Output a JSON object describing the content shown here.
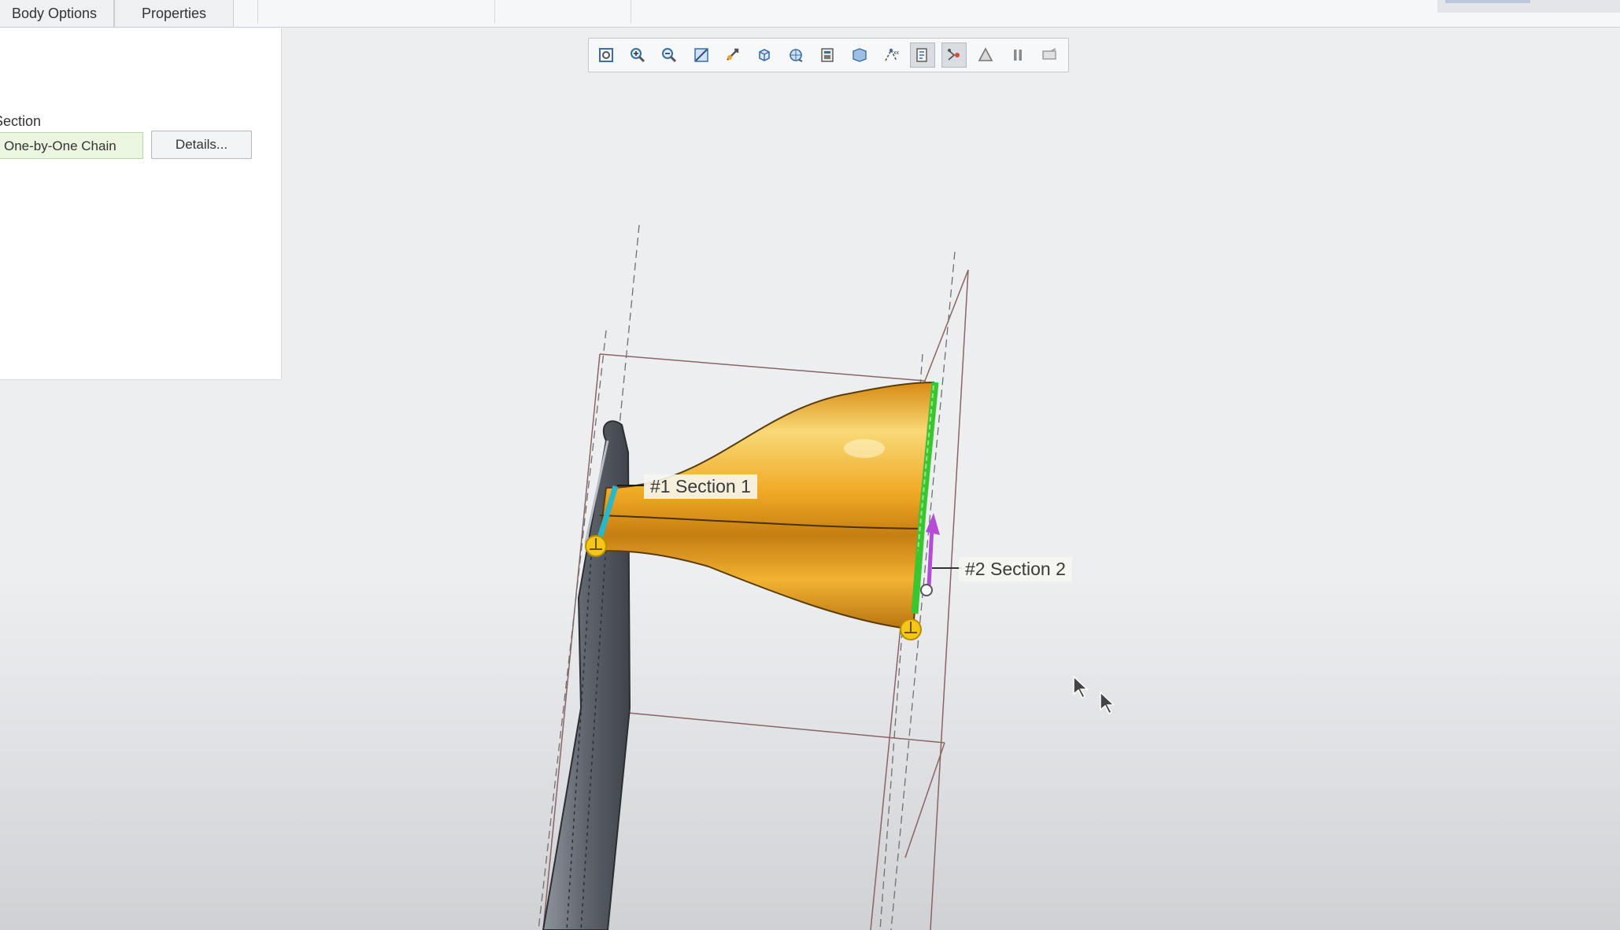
{
  "tabs": [
    {
      "label": "Body Options"
    },
    {
      "label": "Properties"
    }
  ],
  "panel": {
    "section_label": "Section",
    "chain_type": "One-by-One Chain",
    "details_button": "Details..."
  },
  "toolbar": {
    "buttons": [
      {
        "icon": "refit-icon",
        "active": false
      },
      {
        "icon": "zoom-in-icon",
        "active": false
      },
      {
        "icon": "zoom-out-icon",
        "active": false
      },
      {
        "icon": "repaint-icon",
        "active": false
      },
      {
        "icon": "pan-icon",
        "active": false
      },
      {
        "icon": "display-style-icon",
        "active": false
      },
      {
        "icon": "saved-orientations-icon",
        "active": false
      },
      {
        "icon": "view-manager-icon",
        "active": false
      },
      {
        "icon": "perspective-view-icon",
        "active": false
      },
      {
        "icon": "datum-display-icon",
        "active": false
      },
      {
        "icon": "annotation-display-icon",
        "active": true
      },
      {
        "icon": "spin-center-icon",
        "active": true
      },
      {
        "icon": "appearance-icon",
        "active": false
      },
      {
        "icon": "pause-icon",
        "active": false
      },
      {
        "icon": "preview-geometry-icon",
        "active": false
      }
    ]
  },
  "scene": {
    "section1_label": "#1 Section 1",
    "section2_label": "#2 Section 2",
    "colors": {
      "solid": "#f0a823",
      "highlight": "#f8d977",
      "selected_chain": "#39c630",
      "cyan_chain": "#2bb7c6",
      "start_point": "#f5c518",
      "direction_arrow": "#b44cd6",
      "datum_lines": "#8a6464"
    }
  }
}
